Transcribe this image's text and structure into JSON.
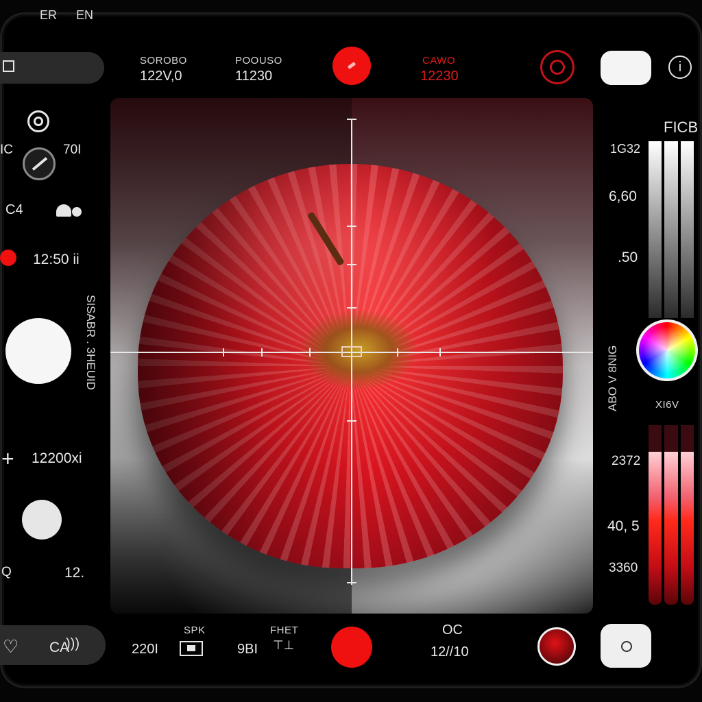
{
  "top_bar": {
    "pill_labels": [
      "ER",
      "EN"
    ],
    "stat1": {
      "label": "SOROBO",
      "value": "122V,0"
    },
    "stat2": {
      "label": "POOUSO",
      "value": "11230"
    },
    "stat3": {
      "label": "CAWO",
      "value": "12230"
    },
    "info_glyph": "i"
  },
  "left_panel": {
    "c_value": "IC",
    "c_value2": "70I",
    "icon_label": "C4",
    "time_label": "12:50 ii",
    "vertical_text": "SISABR . 3HEUID",
    "zoom_label": "12200xi",
    "plus_glyph": "+",
    "bottom_letter": "Q",
    "bottom_value": "12."
  },
  "right_panel": {
    "title": "FICB",
    "level_labels": [
      "1G32",
      "6,60",
      ".50"
    ],
    "vertical_text": "ABO V 8NIG",
    "section_label": "XI6V",
    "red_labels": [
      "2372",
      "40, 5",
      "3360"
    ],
    "gray_levels": [
      1.0,
      1.0,
      1.0
    ],
    "red_levels": [
      0.85,
      0.85,
      0.85
    ]
  },
  "bottom_bar": {
    "pill_label": "CA",
    "left_num": "220I",
    "spk_label": "SPK",
    "fhet_label": "FHET",
    "fhet_num": "9BI",
    "oc_label": "OC",
    "oc_value": "12//10"
  }
}
